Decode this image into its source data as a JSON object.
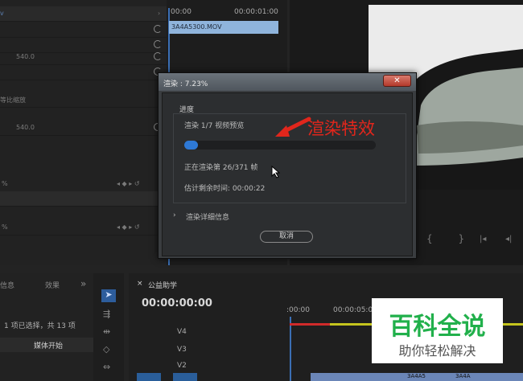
{
  "effects_panel": {
    "value_1": "540.0",
    "label_scale": "等比缩放",
    "value_2": "540.0",
    "label_percent": "%",
    "label_percent2": "%",
    "time_start": "00:00",
    "time_end": "00:00:01:00",
    "clip_name": "3A4A5300.MOV"
  },
  "dialog": {
    "title": "渲染 : 7.23%",
    "close_glyph": "✕",
    "section_label": "进度",
    "task_label": "渲染 1/7 视频预览",
    "progress": 0.0723,
    "frame_status": "正在渲染第 26/371 帧",
    "remaining": "估计剩余时间: 00:00:22",
    "details_toggle": "›",
    "details_label": "渲染详细信息",
    "cancel_label": "取消"
  },
  "annotation": {
    "text": "渲染特效",
    "color": "#e1261c"
  },
  "project_panel": {
    "tab_info": "信息",
    "tab_effects": "效果",
    "more": "»",
    "selection": "1 项已选择，共 13 项",
    "column": "媒体开始"
  },
  "timeline": {
    "sequence_name": "公益助学",
    "timecode": "00:00:00:00",
    "ruler_start": ":00:00",
    "ruler_mid": "00:00:05:00",
    "tracks": [
      "V4",
      "V3",
      "V2"
    ],
    "clip_label_1": "3A4A5",
    "clip_label_2": "3A4A"
  },
  "watermark": {
    "title": "百科全说",
    "subtitle": "助你轻松解决"
  }
}
